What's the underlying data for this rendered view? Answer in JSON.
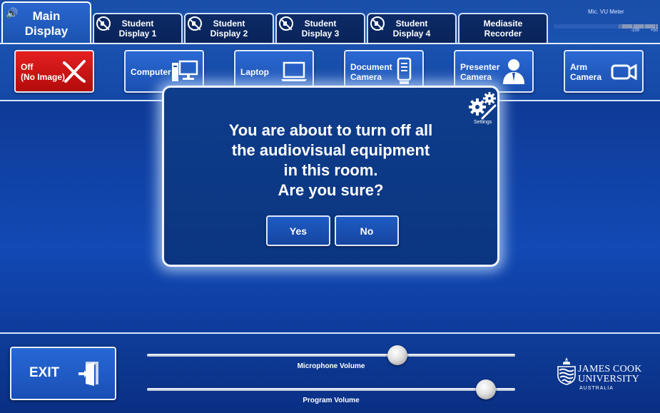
{
  "tabs": {
    "main": {
      "label": "Main\nDisplay"
    },
    "items": [
      {
        "label": "Student\nDisplay 1",
        "muted": true
      },
      {
        "label": "Student\nDisplay 2",
        "muted": true
      },
      {
        "label": "Student\nDisplay 3",
        "muted": true
      },
      {
        "label": "Student\nDisplay 4",
        "muted": true
      },
      {
        "label": "Mediasite\nRecorder",
        "muted": false
      }
    ]
  },
  "vu_meter": {
    "title": "Mic. VU Meter",
    "ticks": [
      "-100",
      "+50"
    ]
  },
  "sources": [
    {
      "label": "Off\n(No Image)",
      "icon": "red-x-icon"
    },
    {
      "label": "Computer",
      "icon": "desktop-computer-icon"
    },
    {
      "label": "Laptop",
      "icon": "laptop-icon"
    },
    {
      "label": "Document\nCamera",
      "icon": "document-camera-icon"
    },
    {
      "label": "Presenter\nCamera",
      "icon": "presenter-icon"
    },
    {
      "label": "Arm\nCamera",
      "icon": "video-camera-icon"
    }
  ],
  "dialog": {
    "message": "You are about to turn off all\nthe audiovisual equipment\nin this room.\nAre you sure?",
    "settings_label": "Settings",
    "yes_label": "Yes",
    "no_label": "No"
  },
  "bottom": {
    "exit_label": "EXIT",
    "microphone_volume": {
      "label": "Microphone Volume",
      "level": 0.68
    },
    "program_volume": {
      "label": "Program Volume",
      "level": 0.92
    }
  },
  "logo": {
    "line1": "JAMES COOK",
    "line2": "UNIVERSITY",
    "line3": "AUSTRALIA"
  },
  "colors": {
    "off_red": "#d41616",
    "button_blue": "#1f5cc4",
    "background_blue": "#0f3d9c"
  }
}
